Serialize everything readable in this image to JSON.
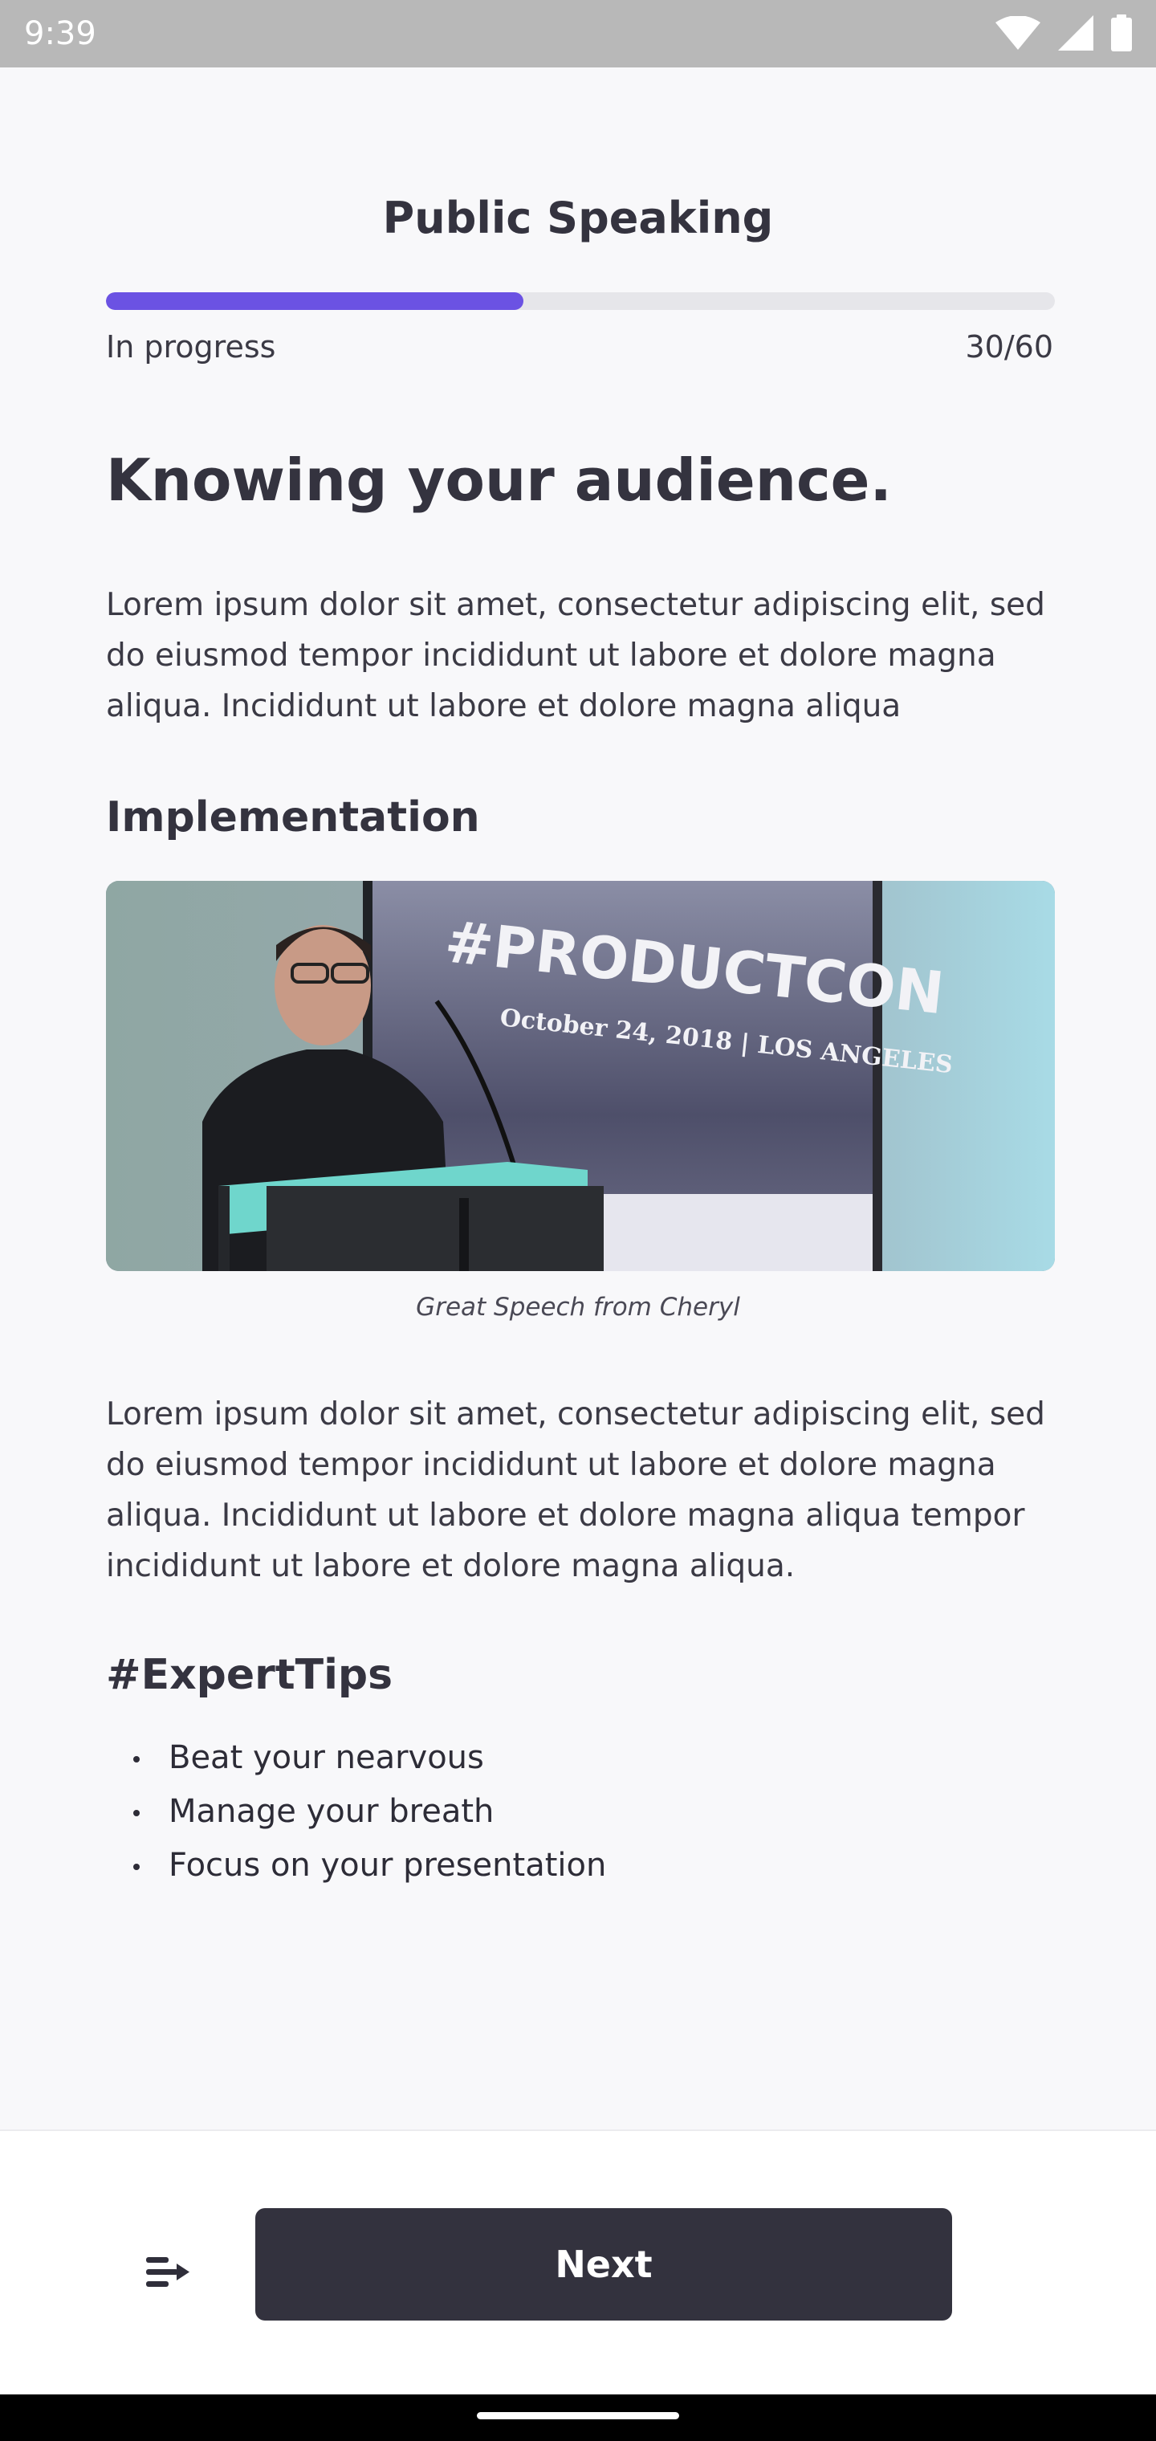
{
  "status_bar": {
    "time": "9:39",
    "icons": [
      "wifi-icon",
      "signal-icon",
      "battery-icon"
    ]
  },
  "header": {
    "title": "Public Speaking"
  },
  "progress": {
    "status": "In progress",
    "count": "30/60",
    "fraction": 0.44,
    "color": "#6b52e3"
  },
  "lesson": {
    "heading": "Knowing your audience.",
    "intro": "Lorem ipsum dolor sit amet, consectetur adipiscing elit, sed do eiusmod tempor incididunt ut labore et dolore magna aliqua. Incididunt ut labore et dolore magna aliqua",
    "section_heading": "Implementation",
    "image": {
      "screen_text_line1": "#PRODUCTCON",
      "screen_text_line2": "October 24, 2018 | LOS ANGELES",
      "caption": "Great Speech from Cheryl"
    },
    "body": "Lorem ipsum dolor sit amet, consectetur adipiscing elit, sed do eiusmod tempor incididunt ut labore et dolore magna aliqua. Incididunt ut labore et dolore magna aliqua tempor incididunt ut labore et dolore magna aliqua.",
    "tips_heading": "#ExpertTips",
    "tips": [
      "Beat your nearvous",
      "Manage your breath",
      "Focus on your presentation"
    ]
  },
  "footer": {
    "menu_icon": "lesson-menu-icon",
    "next_label": "Next"
  }
}
